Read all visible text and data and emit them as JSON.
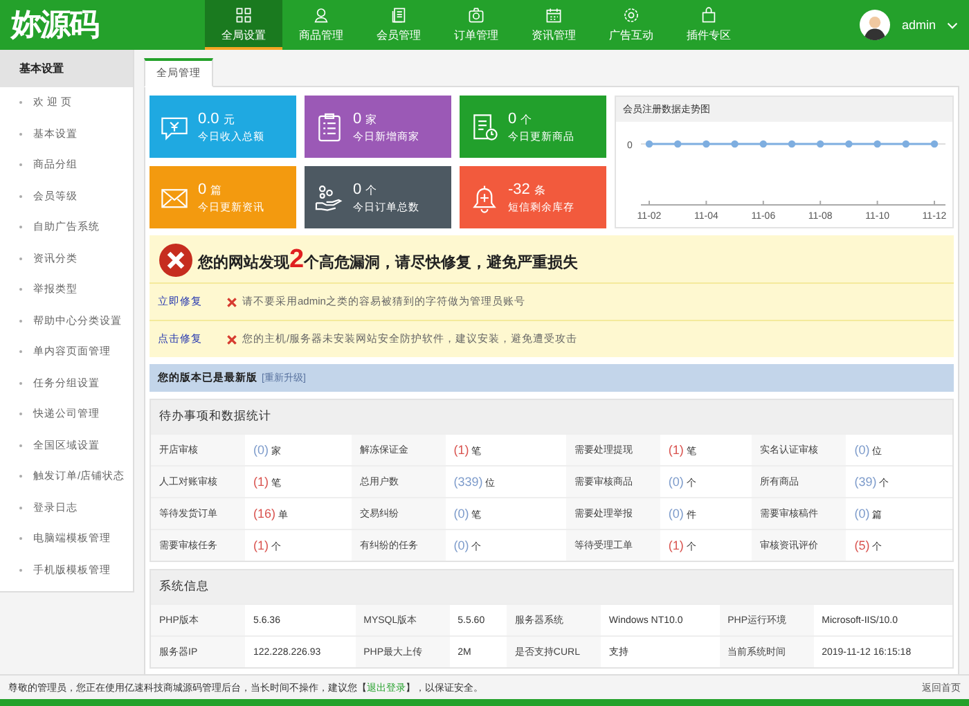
{
  "logo": "妳源码",
  "nav": [
    {
      "label": "全局设置",
      "selected": true
    },
    {
      "label": "商品管理",
      "selected": false
    },
    {
      "label": "会员管理",
      "selected": false
    },
    {
      "label": "订单管理",
      "selected": false
    },
    {
      "label": "资讯管理",
      "selected": false
    },
    {
      "label": "广告互动",
      "selected": false
    },
    {
      "label": "插件专区",
      "selected": false
    }
  ],
  "user": {
    "name": "admin"
  },
  "sidebar": {
    "title": "基本设置",
    "items": [
      "欢 迎 页",
      "基本设置",
      "商品分组",
      "会员等级",
      "自助广告系统",
      "资讯分类",
      "举报类型",
      "帮助中心分类设置",
      "单内容页面管理",
      "任务分组设置",
      "快递公司管理",
      "全国区域设置",
      "触发订单/店铺状态",
      "登录日志",
      "电脑端模板管理",
      "手机版模板管理"
    ]
  },
  "tabs": [
    {
      "label": "全局管理",
      "selected": true
    }
  ],
  "cards": [
    {
      "kind": "money",
      "value": "0.0",
      "unit": "元",
      "label": "今日收入总额",
      "color": "#1fa9e1"
    },
    {
      "kind": "clipboard",
      "value": "0",
      "unit": "家",
      "label": "今日新增商家",
      "color": "#9b59b6"
    },
    {
      "kind": "document",
      "value": "0",
      "unit": "个",
      "label": "今日更新商品",
      "color": "#22a02c"
    },
    {
      "kind": "mail",
      "value": "0",
      "unit": "篇",
      "label": "今日更新资讯",
      "color": "#f39a0f"
    },
    {
      "kind": "hand",
      "value": "0",
      "unit": "个",
      "label": "今日订单总数",
      "color": "#4d5962"
    },
    {
      "kind": "bell",
      "value": "-32",
      "unit": "条",
      "label": "短信剩余库存",
      "color": "#f25a3d"
    }
  ],
  "chart": {
    "title": "会员注册数据走势图",
    "y_label": "0",
    "x_labels": [
      "11-02",
      "11-04",
      "11-06",
      "11-08",
      "11-10",
      "11-12"
    ]
  },
  "alert": {
    "before": "您的网站发现",
    "count": "2",
    "after": "个高危漏洞，请尽快修复，避免严重损失",
    "items": [
      {
        "action": "立即修复",
        "text": "请不要采用admin之类的容易被猜到的字符做为管理员账号"
      },
      {
        "action": "点击修复",
        "text": "您的主机/服务器未安装网站安全防护软件，建议安装，避免遭受攻击"
      }
    ]
  },
  "version": {
    "text": "您的版本已是最新版",
    "link": "[重新升级]"
  },
  "todo": {
    "title": "待办事项和数据统计",
    "rows": [
      [
        {
          "label": "开店审核",
          "value": "(0)",
          "unit": "家",
          "color": "#7e9ccb"
        },
        {
          "label": "解冻保证金",
          "value": "(1)",
          "unit": "笔",
          "color": "#d9534f"
        },
        {
          "label": "需要处理提现",
          "value": "(1)",
          "unit": "笔",
          "color": "#d9534f"
        },
        {
          "label": "实名认证审核",
          "value": "(0)",
          "unit": "位",
          "color": "#7e9ccb"
        }
      ],
      [
        {
          "label": "人工对账审核",
          "value": "(1)",
          "unit": "笔",
          "color": "#d9534f"
        },
        {
          "label": "总用户数",
          "value": "(339)",
          "unit": "位",
          "color": "#7e9ccb"
        },
        {
          "label": "需要审核商品",
          "value": "(0)",
          "unit": "个",
          "color": "#7e9ccb"
        },
        {
          "label": "所有商品",
          "value": "(39)",
          "unit": "个",
          "color": "#7e9ccb"
        }
      ],
      [
        {
          "label": "等待发货订单",
          "value": "(16)",
          "unit": "单",
          "color": "#d9534f"
        },
        {
          "label": "交易纠纷",
          "value": "(0)",
          "unit": "笔",
          "color": "#7e9ccb"
        },
        {
          "label": "需要处理举报",
          "value": "(0)",
          "unit": "件",
          "color": "#7e9ccb"
        },
        {
          "label": "需要审核稿件",
          "value": "(0)",
          "unit": "篇",
          "color": "#7e9ccb"
        }
      ],
      [
        {
          "label": "需要审核任务",
          "value": "(1)",
          "unit": "个",
          "color": "#d9534f"
        },
        {
          "label": "有纠纷的任务",
          "value": "(0)",
          "unit": "个",
          "color": "#7e9ccb"
        },
        {
          "label": "等待受理工单",
          "value": "(1)",
          "unit": "个",
          "color": "#d9534f"
        },
        {
          "label": "审核资讯评价",
          "value": "(5)",
          "unit": "个",
          "color": "#d9534f"
        }
      ]
    ]
  },
  "sysinfo": {
    "title": "系统信息",
    "rows": [
      [
        {
          "label": "PHP版本",
          "value": "5.6.36"
        },
        {
          "label": "MYSQL版本",
          "value": "5.5.60"
        },
        {
          "label": "服务器系统",
          "value": "Windows NT10.0"
        },
        {
          "label": "PHP运行环境",
          "value": "Microsoft-IIS/10.0"
        }
      ],
      [
        {
          "label": "服务器IP",
          "value": "122.228.226.93"
        },
        {
          "label": "PHP最大上传",
          "value": "2M"
        },
        {
          "label": "是否支持CURL",
          "value": "支持"
        },
        {
          "label": "当前系统时间",
          "value": "2019-11-12 16:15:18"
        }
      ]
    ]
  },
  "footer": {
    "before": "尊敬的管理员，您正在使用亿速科技商城源码管理后台，当长时间不操作，建议您【",
    "link": "退出登录",
    "after": "】，以保证安全。",
    "home": "返回首页"
  }
}
